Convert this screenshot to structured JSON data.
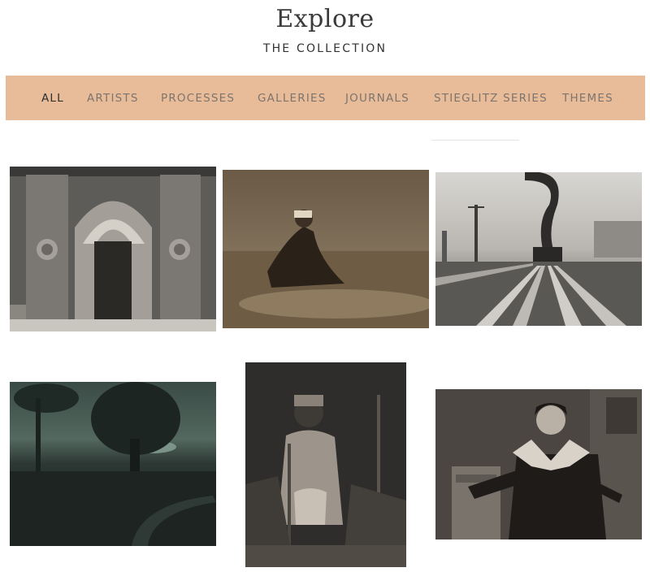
{
  "header": {
    "title": "Explore",
    "subtitle": "THE COLLECTION"
  },
  "nav": {
    "items": [
      {
        "label": "ALL",
        "active": true
      },
      {
        "label": "ARTISTS"
      },
      {
        "label": "PROCESSES"
      },
      {
        "label": "GALLERIES"
      },
      {
        "label": "JOURNALS"
      },
      {
        "label": "STIEGLITZ SERIES"
      },
      {
        "label": "THEMES"
      }
    ]
  },
  "colors": {
    "nav_bg": "#e8bc98",
    "nav_text": "#7d746e",
    "nav_active": "#2f2f2f"
  }
}
